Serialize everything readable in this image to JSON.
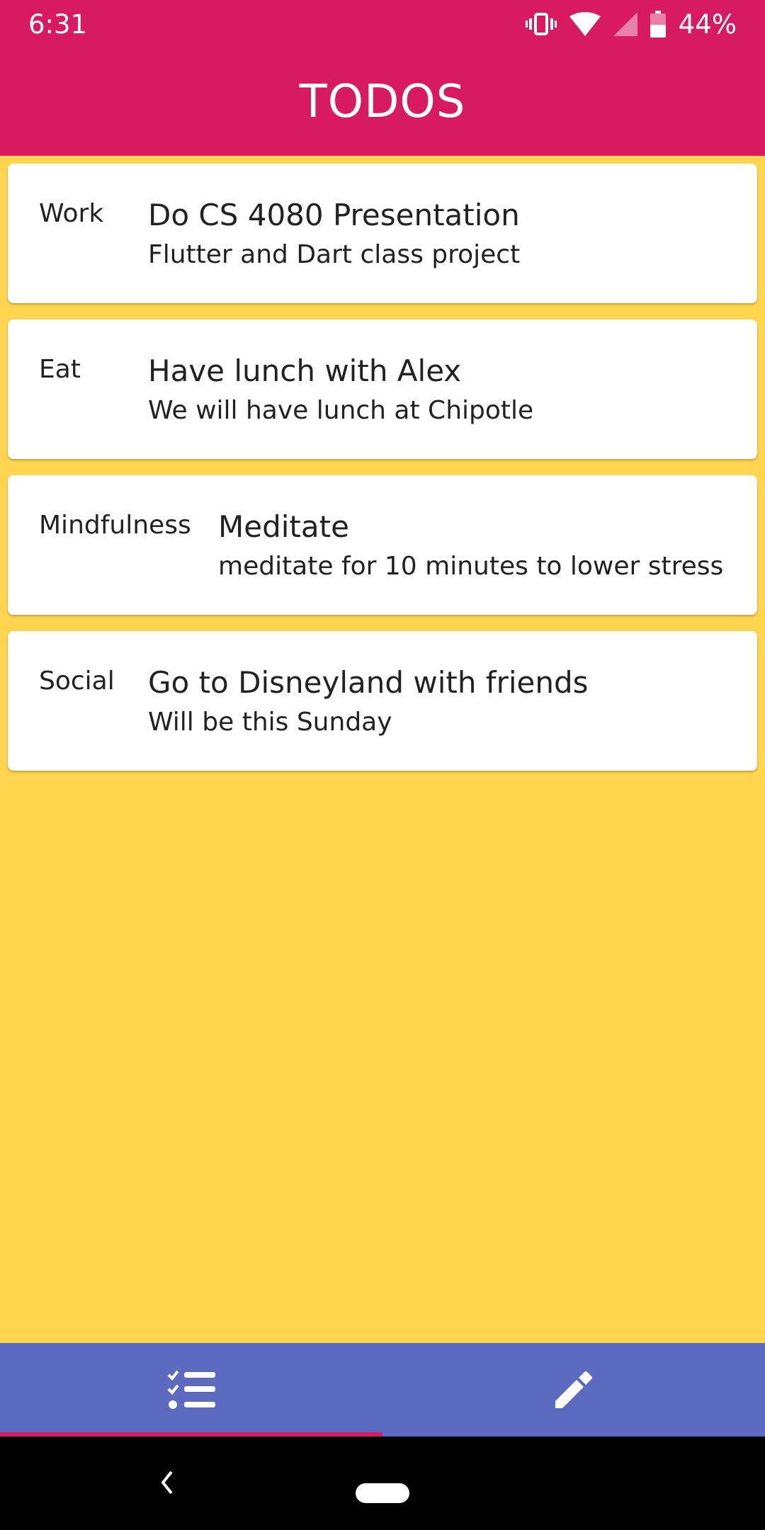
{
  "status_bar": {
    "time": "6:31",
    "battery": "44%",
    "icons": [
      "vibrate-icon",
      "wifi-icon",
      "signal-icon",
      "battery-icon"
    ]
  },
  "app_bar": {
    "title": "TODOS"
  },
  "todos": [
    {
      "category": "Work",
      "title": "Do CS 4080 Presentation",
      "description": "Flutter and Dart class project"
    },
    {
      "category": "Eat",
      "title": "Have lunch with Alex",
      "description": "We will have lunch at Chipotle"
    },
    {
      "category": "Mindfulness",
      "title": "Meditate",
      "description": "meditate for 10 minutes to lower stress"
    },
    {
      "category": "Social",
      "title": "Go to Disneyland with friends",
      "description": "Will be this Sunday"
    }
  ],
  "bottom_nav": {
    "tabs": [
      {
        "icon": "checklist-icon",
        "selected": true
      },
      {
        "icon": "pencil-icon",
        "selected": false
      }
    ]
  },
  "colors": {
    "primary": "#D81B60",
    "background": "#FFD54F",
    "nav": "#5C6BC0"
  }
}
